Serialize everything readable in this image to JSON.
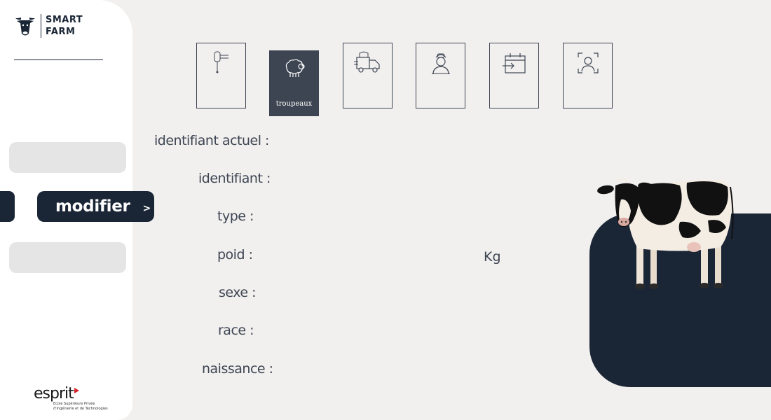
{
  "brand": {
    "line1": "SMART",
    "line2": "FARM"
  },
  "sidebar": {
    "modifier_label": "modifier",
    "modifier_chevron": ">"
  },
  "top_icons": [
    {
      "name": "sensor-icon"
    },
    {
      "name": "sheep-icon",
      "label": "troupeaux",
      "active": true
    },
    {
      "name": "delivery-truck-icon"
    },
    {
      "name": "farmer-icon"
    },
    {
      "name": "calendar-entry-icon"
    },
    {
      "name": "face-scan-icon"
    }
  ],
  "form": {
    "current_id_label": "identifiant actuel :",
    "id_label": "identifiant :",
    "type_label": "type :",
    "weight_label": "poid :",
    "weight_unit": "Kg",
    "sex_label": "sexe :",
    "breed_label": "race :",
    "birth_label": "naissance :"
  },
  "footer": {
    "school_brand": "esprit",
    "school_sub": "Ecole Supérieure Privée d'Ingénierie et de Technologies"
  },
  "colors": {
    "navy": "#1a2535",
    "slate": "#3e4552",
    "background": "#f1f0ef"
  }
}
